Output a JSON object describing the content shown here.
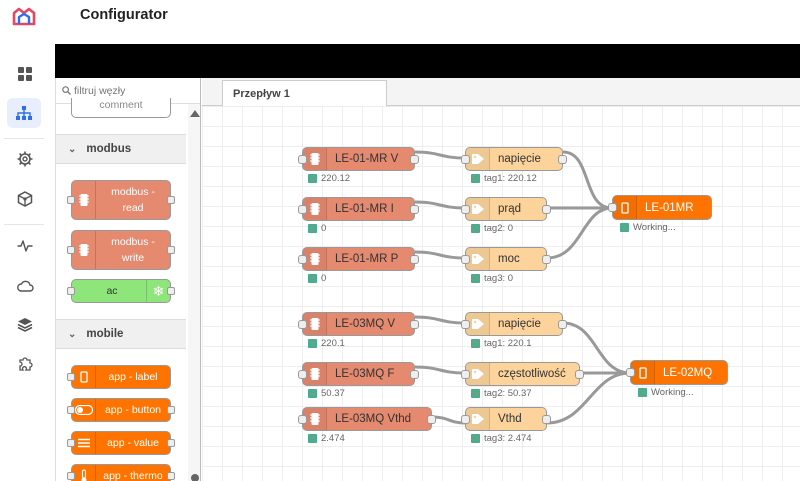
{
  "app": {
    "title": "Configurator",
    "colors": {
      "accent": "#2f6fe6",
      "logo": "#e8475f",
      "modbus_node": "#e5896f",
      "tag_node": "#fbd39b",
      "app_node": "#ff7400",
      "ac_node": "#8ee67a",
      "status_ok": "#55aa88"
    }
  },
  "sidebar": {
    "icons": [
      "logo-icon",
      "dashboard-icon",
      "flows-icon",
      "settings-icon",
      "cube-icon",
      "activity-icon",
      "cloud-icon",
      "layers-icon",
      "plugin-icon"
    ]
  },
  "palette": {
    "filter_placeholder": "filtruj węzły",
    "comment_label": "comment",
    "categories": [
      {
        "name": "modbus",
        "nodes": [
          "modbus - read",
          "modbus - write",
          "ac"
        ]
      },
      {
        "name": "mobile",
        "nodes": [
          "app - label",
          "app - button",
          "app - value",
          "app - thermo"
        ]
      }
    ]
  },
  "workspace": {
    "tab_label": "Przepływ 1",
    "nodes": {
      "m1": {
        "label": "LE-01-MR V",
        "status": "220.12"
      },
      "m2": {
        "label": "LE-01-MR I",
        "status": "0"
      },
      "m3": {
        "label": "LE-01-MR P",
        "status": "0"
      },
      "m4": {
        "label": "LE-03MQ V",
        "status": "220.1"
      },
      "m5": {
        "label": "LE-03MQ F",
        "status": "50.37"
      },
      "m6": {
        "label": "LE-03MQ Vthd",
        "status": "2.474"
      },
      "t1": {
        "label": "napięcie",
        "status": "tag1: 220.12"
      },
      "t2": {
        "label": "prąd",
        "status": "tag2: 0"
      },
      "t3": {
        "label": "moc",
        "status": "tag3: 0"
      },
      "t4": {
        "label": "napięcie",
        "status": "tag1: 220.1"
      },
      "t5": {
        "label": "częstotliwość",
        "status": "tag2: 50.37"
      },
      "t6": {
        "label": "Vthd",
        "status": "tag3: 2.474"
      },
      "a1": {
        "label": "LE-01MR",
        "status": "Working..."
      },
      "a2": {
        "label": "LE-02MQ",
        "status": "Working..."
      }
    }
  }
}
